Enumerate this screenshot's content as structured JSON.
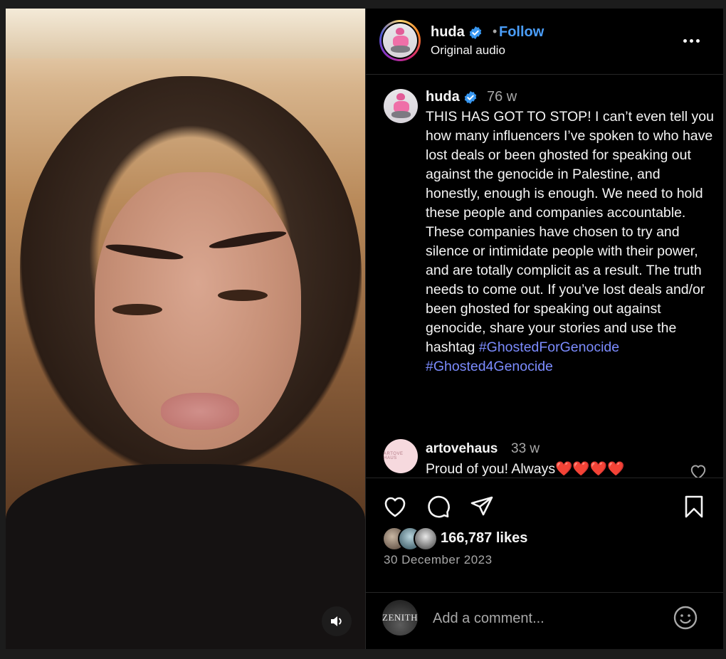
{
  "header": {
    "username": "huda",
    "separator": "•",
    "follow_label": "Follow",
    "audio_label": "Original audio"
  },
  "caption": {
    "username": "huda",
    "time": "76 w",
    "text": "THIS HAS GOT TO STOP! I can’t even tell you how many influencers I’ve spoken to who have lost deals or been ghosted for speaking out against the genocide in Palestine, and honestly, enough is enough. We need to hold these people and companies accountable. These companies have chosen to try and silence or intimidate people with their power, and are totally complicit as a result. The truth needs to come out. If you’ve lost deals and/or been ghosted for speaking out against genocide, share your stories and use the hashtag",
    "hashtag1": "#GhostedForGenocide",
    "hashtag2": "#Ghosted4Genocide"
  },
  "comment": {
    "username": "artovehaus",
    "time": "33 w",
    "text": "Proud of you! Always❤️❤️❤️❤️",
    "avatar_text": "ARTOVE HAUS"
  },
  "post": {
    "likes": "166,787 likes",
    "date": "30 December 2023"
  },
  "add_comment": {
    "placeholder": "Add a comment...",
    "avatar_text": "ZENITH"
  },
  "colors": {
    "accent": "#4a9df8",
    "hashtag": "#7c8cff",
    "verified": "#3897f0",
    "secondary_text": "#a8a8a8",
    "background": "#000000"
  },
  "icons": [
    "volume-icon",
    "verified-icon",
    "more-icon",
    "heart-icon",
    "comment-icon",
    "share-icon",
    "bookmark-icon",
    "emoji-icon"
  ]
}
